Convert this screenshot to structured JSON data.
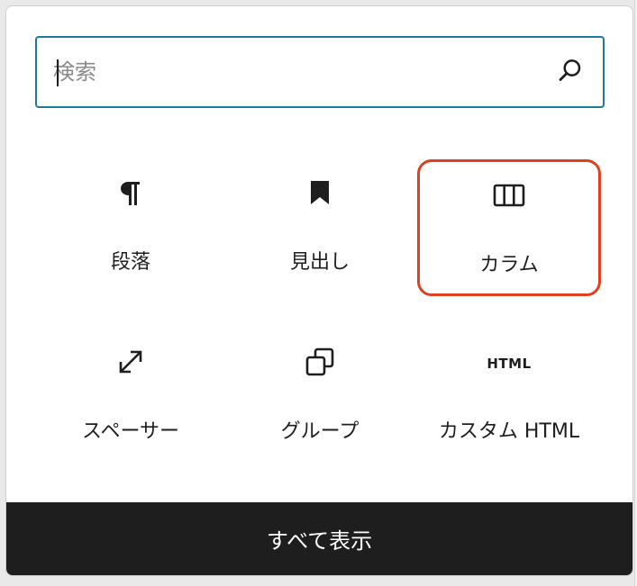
{
  "search": {
    "placeholder": "検索",
    "value": "",
    "icon": "search-icon"
  },
  "blocks": [
    {
      "label": "段落",
      "icon": "paragraph-icon",
      "highlighted": false
    },
    {
      "label": "見出し",
      "icon": "bookmark-icon",
      "highlighted": false
    },
    {
      "label": "カラム",
      "icon": "columns-icon",
      "highlighted": true
    },
    {
      "label": "スペーサー",
      "icon": "resize-arrow-icon",
      "highlighted": false
    },
    {
      "label": "グループ",
      "icon": "group-icon",
      "highlighted": false
    },
    {
      "label": "カスタム HTML",
      "icon": "html-icon",
      "icon_text": "HTML",
      "highlighted": false
    }
  ],
  "footer": {
    "show_all_label": "すべて表示"
  },
  "colors": {
    "focus_border": "#1e7a98",
    "highlight_border": "#e0401f",
    "footer_bg": "#1e1e1e",
    "text": "#1e1e1e"
  }
}
